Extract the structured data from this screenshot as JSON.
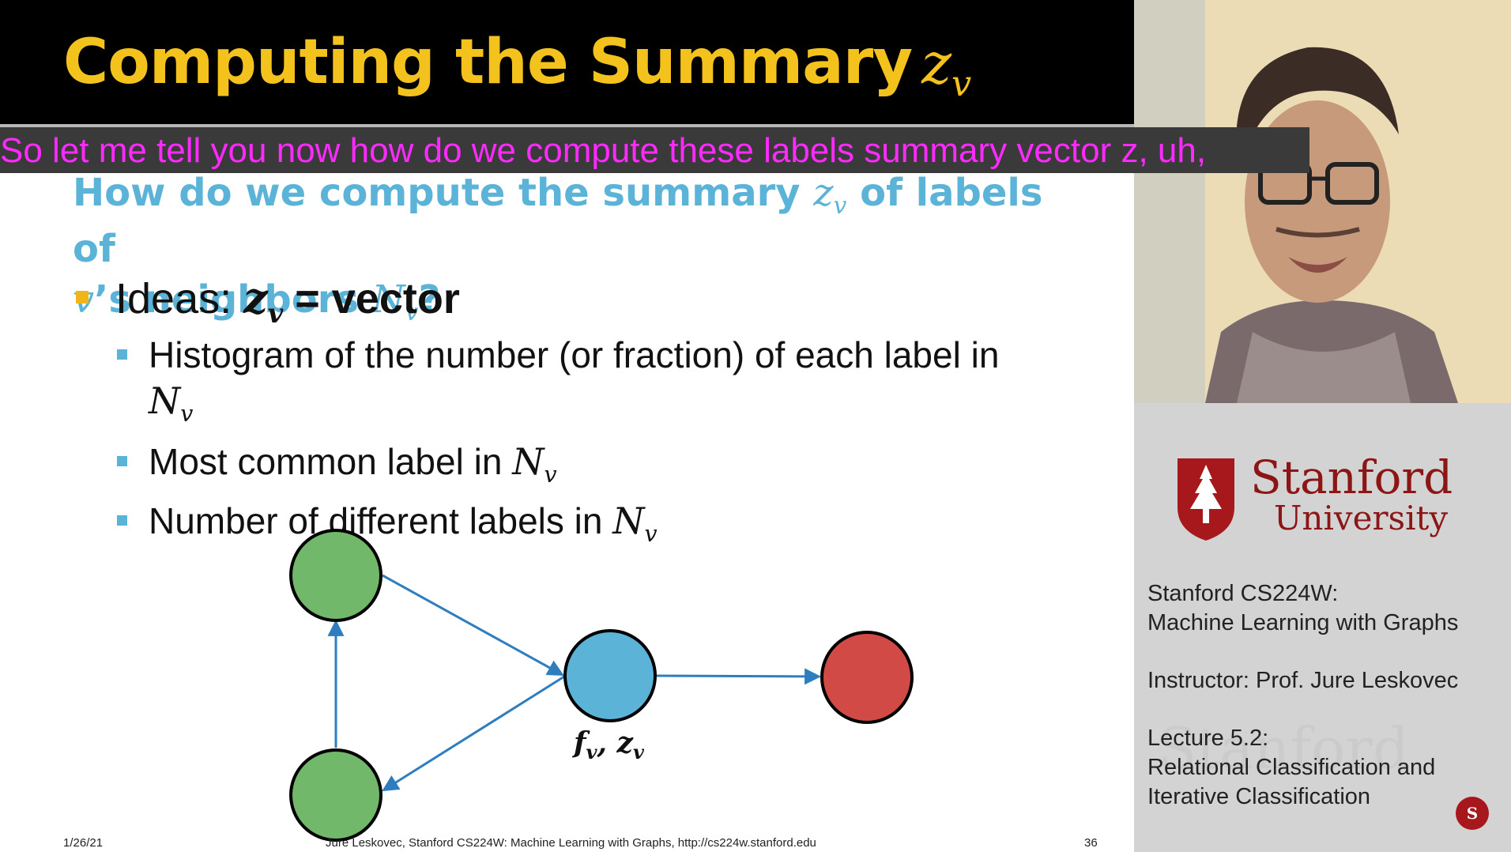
{
  "slide": {
    "title_text": "Computing the Summary",
    "title_var": "z",
    "title_sub": "v",
    "question": {
      "part1": "How do we compute the summary ",
      "var": "z",
      "sub": "v",
      "part2": " of labels of",
      "line2_var": "v",
      "line2_text": "’s neighbors ",
      "line2_N": "N",
      "line2_Nsub": "v",
      "q": "?"
    },
    "idea": {
      "label": "Ideas: ",
      "var": "z",
      "sub": "v",
      "rest": " = vector"
    },
    "subbullets": [
      {
        "text": "Histogram of the number (or fraction) of each label in",
        "var": "N",
        "sub": "v"
      },
      {
        "text": "Most common label in ",
        "var": "N",
        "sub": "v"
      },
      {
        "text": "Number of different labels in ",
        "var": "N",
        "sub": "v"
      }
    ],
    "graph_label": "f",
    "graph_label_sub1": "v",
    "graph_label_sep": ", ",
    "graph_label_z": "z",
    "graph_label_sub2": "v",
    "footer": {
      "date": "1/26/21",
      "credit": "Jure Leskovec, Stanford CS224W: Machine Learning with Graphs, http://cs224w.stanford.edu",
      "page": "36"
    },
    "colors": {
      "green": "#72b86a",
      "blue": "#5bb4d7",
      "red": "#d14a45",
      "edge": "#2e7ebf",
      "title": "#f4c21c"
    }
  },
  "subtitle": "So let me tell you now how do we compute these labels summary vector z, uh,",
  "sidebar": {
    "logo_line1": "Stanford",
    "logo_line2": "University",
    "course_line1": "Stanford CS224W:",
    "course_line2": "Machine Learning with Graphs",
    "instructor": "Instructor: Prof. Jure Leskovec",
    "lecture_line1": "Lecture 5.2:",
    "lecture_line2": "Relational Classification and",
    "lecture_line3": "Iterative Classification",
    "watermark": "Stanford"
  }
}
